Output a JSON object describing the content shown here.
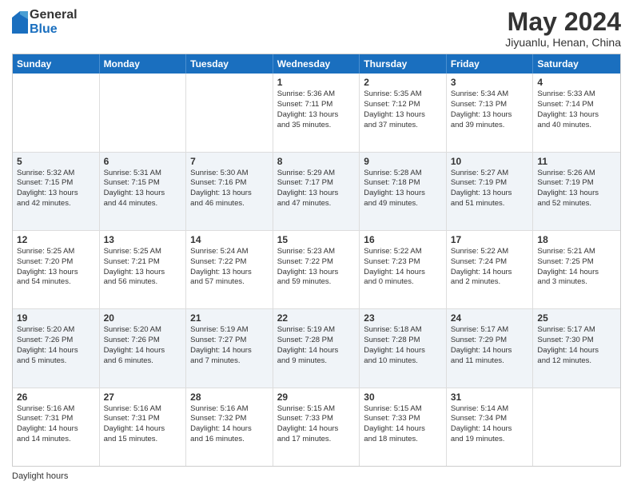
{
  "logo": {
    "general": "General",
    "blue": "Blue"
  },
  "header": {
    "month": "May 2024",
    "location": "Jiyuanlu, Henan, China"
  },
  "days_of_week": [
    "Sunday",
    "Monday",
    "Tuesday",
    "Wednesday",
    "Thursday",
    "Friday",
    "Saturday"
  ],
  "footer": {
    "label": "Daylight hours"
  },
  "rows": [
    {
      "alt": false,
      "cells": [
        {
          "day": "",
          "info": ""
        },
        {
          "day": "",
          "info": ""
        },
        {
          "day": "",
          "info": ""
        },
        {
          "day": "1",
          "info": "Sunrise: 5:36 AM\nSunset: 7:11 PM\nDaylight: 13 hours\nand 35 minutes."
        },
        {
          "day": "2",
          "info": "Sunrise: 5:35 AM\nSunset: 7:12 PM\nDaylight: 13 hours\nand 37 minutes."
        },
        {
          "day": "3",
          "info": "Sunrise: 5:34 AM\nSunset: 7:13 PM\nDaylight: 13 hours\nand 39 minutes."
        },
        {
          "day": "4",
          "info": "Sunrise: 5:33 AM\nSunset: 7:14 PM\nDaylight: 13 hours\nand 40 minutes."
        }
      ]
    },
    {
      "alt": true,
      "cells": [
        {
          "day": "5",
          "info": "Sunrise: 5:32 AM\nSunset: 7:15 PM\nDaylight: 13 hours\nand 42 minutes."
        },
        {
          "day": "6",
          "info": "Sunrise: 5:31 AM\nSunset: 7:15 PM\nDaylight: 13 hours\nand 44 minutes."
        },
        {
          "day": "7",
          "info": "Sunrise: 5:30 AM\nSunset: 7:16 PM\nDaylight: 13 hours\nand 46 minutes."
        },
        {
          "day": "8",
          "info": "Sunrise: 5:29 AM\nSunset: 7:17 PM\nDaylight: 13 hours\nand 47 minutes."
        },
        {
          "day": "9",
          "info": "Sunrise: 5:28 AM\nSunset: 7:18 PM\nDaylight: 13 hours\nand 49 minutes."
        },
        {
          "day": "10",
          "info": "Sunrise: 5:27 AM\nSunset: 7:19 PM\nDaylight: 13 hours\nand 51 minutes."
        },
        {
          "day": "11",
          "info": "Sunrise: 5:26 AM\nSunset: 7:19 PM\nDaylight: 13 hours\nand 52 minutes."
        }
      ]
    },
    {
      "alt": false,
      "cells": [
        {
          "day": "12",
          "info": "Sunrise: 5:25 AM\nSunset: 7:20 PM\nDaylight: 13 hours\nand 54 minutes."
        },
        {
          "day": "13",
          "info": "Sunrise: 5:25 AM\nSunset: 7:21 PM\nDaylight: 13 hours\nand 56 minutes."
        },
        {
          "day": "14",
          "info": "Sunrise: 5:24 AM\nSunset: 7:22 PM\nDaylight: 13 hours\nand 57 minutes."
        },
        {
          "day": "15",
          "info": "Sunrise: 5:23 AM\nSunset: 7:22 PM\nDaylight: 13 hours\nand 59 minutes."
        },
        {
          "day": "16",
          "info": "Sunrise: 5:22 AM\nSunset: 7:23 PM\nDaylight: 14 hours\nand 0 minutes."
        },
        {
          "day": "17",
          "info": "Sunrise: 5:22 AM\nSunset: 7:24 PM\nDaylight: 14 hours\nand 2 minutes."
        },
        {
          "day": "18",
          "info": "Sunrise: 5:21 AM\nSunset: 7:25 PM\nDaylight: 14 hours\nand 3 minutes."
        }
      ]
    },
    {
      "alt": true,
      "cells": [
        {
          "day": "19",
          "info": "Sunrise: 5:20 AM\nSunset: 7:26 PM\nDaylight: 14 hours\nand 5 minutes."
        },
        {
          "day": "20",
          "info": "Sunrise: 5:20 AM\nSunset: 7:26 PM\nDaylight: 14 hours\nand 6 minutes."
        },
        {
          "day": "21",
          "info": "Sunrise: 5:19 AM\nSunset: 7:27 PM\nDaylight: 14 hours\nand 7 minutes."
        },
        {
          "day": "22",
          "info": "Sunrise: 5:19 AM\nSunset: 7:28 PM\nDaylight: 14 hours\nand 9 minutes."
        },
        {
          "day": "23",
          "info": "Sunrise: 5:18 AM\nSunset: 7:28 PM\nDaylight: 14 hours\nand 10 minutes."
        },
        {
          "day": "24",
          "info": "Sunrise: 5:17 AM\nSunset: 7:29 PM\nDaylight: 14 hours\nand 11 minutes."
        },
        {
          "day": "25",
          "info": "Sunrise: 5:17 AM\nSunset: 7:30 PM\nDaylight: 14 hours\nand 12 minutes."
        }
      ]
    },
    {
      "alt": false,
      "cells": [
        {
          "day": "26",
          "info": "Sunrise: 5:16 AM\nSunset: 7:31 PM\nDaylight: 14 hours\nand 14 minutes."
        },
        {
          "day": "27",
          "info": "Sunrise: 5:16 AM\nSunset: 7:31 PM\nDaylight: 14 hours\nand 15 minutes."
        },
        {
          "day": "28",
          "info": "Sunrise: 5:16 AM\nSunset: 7:32 PM\nDaylight: 14 hours\nand 16 minutes."
        },
        {
          "day": "29",
          "info": "Sunrise: 5:15 AM\nSunset: 7:33 PM\nDaylight: 14 hours\nand 17 minutes."
        },
        {
          "day": "30",
          "info": "Sunrise: 5:15 AM\nSunset: 7:33 PM\nDaylight: 14 hours\nand 18 minutes."
        },
        {
          "day": "31",
          "info": "Sunrise: 5:14 AM\nSunset: 7:34 PM\nDaylight: 14 hours\nand 19 minutes."
        },
        {
          "day": "",
          "info": ""
        }
      ]
    }
  ]
}
